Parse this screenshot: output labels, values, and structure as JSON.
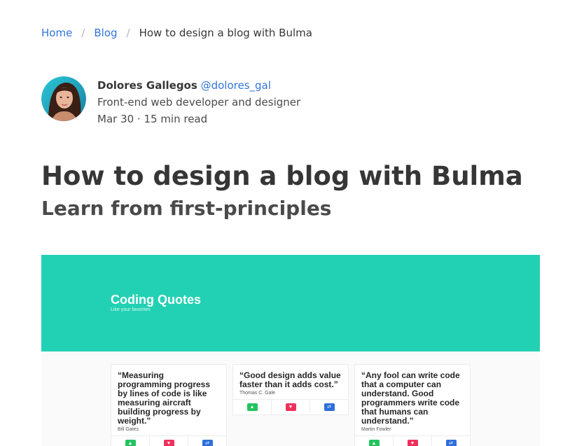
{
  "breadcrumb": {
    "items": [
      "Home",
      "Blog"
    ],
    "current": "How to design a blog with Bulma"
  },
  "author": {
    "name": "Dolores Gallegos",
    "handle": "@dolores_gal",
    "bio": "Front-end web developer and designer",
    "meta": "Mar 30 · 15 min read"
  },
  "article": {
    "title": "How to design a blog with Bulma",
    "subtitle": "Learn from first-principles"
  },
  "hero": {
    "app_title": "Coding Quotes",
    "app_subtitle": "Like your favorites",
    "quotes": [
      {
        "text": "“Measuring programming progress by lines of code is like measuring aircraft building progress by weight.”",
        "author": "Bill Gates"
      },
      {
        "text": "“Good design adds value faster than it adds cost.”",
        "author": "Thomas C. Gale"
      },
      {
        "text": "“Any fool can write code that a computer can understand. Good programmers write code that humans can understand.”",
        "author": "Martin Fowler"
      }
    ]
  },
  "colors": {
    "link": "#3273dc",
    "banner": "#22d1b3",
    "like": "#23c45e",
    "dislike": "#f0305c",
    "share": "#2d6fdb"
  },
  "icons": {
    "like": "thumbs-up-icon",
    "dislike": "thumbs-down-icon",
    "share": "retweet-icon"
  }
}
